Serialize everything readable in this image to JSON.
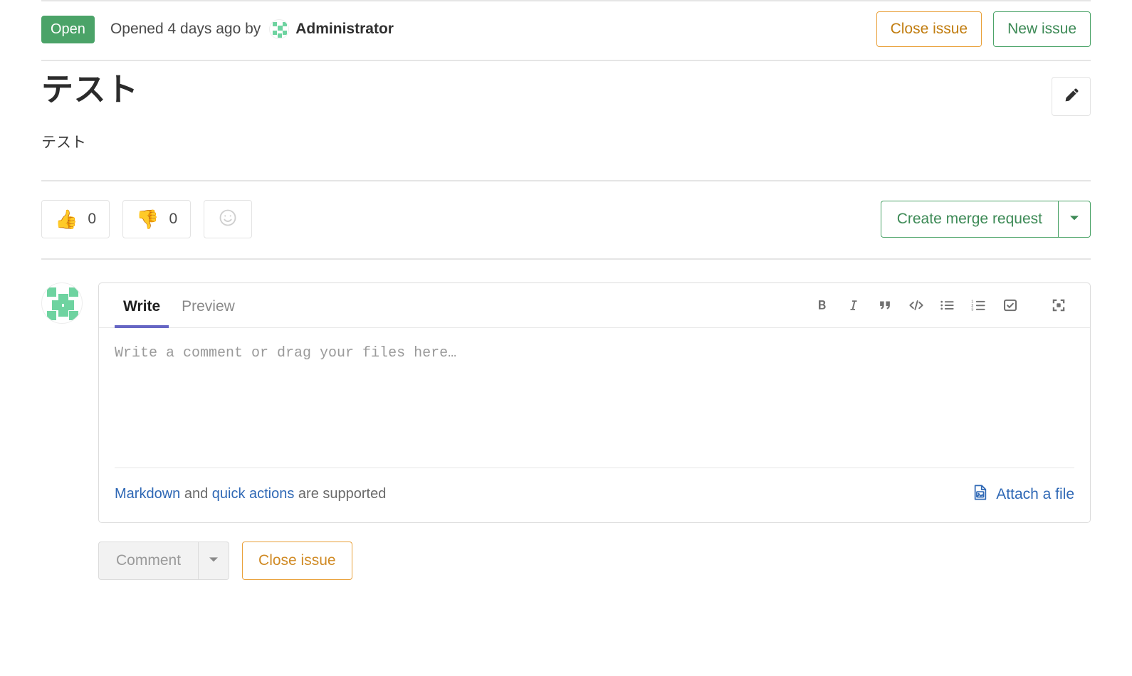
{
  "header": {
    "state_badge": "Open",
    "opened_text": "Opened 4 days ago by",
    "author": "Administrator",
    "close_issue_label": "Close issue",
    "new_issue_label": "New issue"
  },
  "issue": {
    "title": "テスト",
    "description": "テスト",
    "edit_icon": "pencil-icon"
  },
  "awards": {
    "thumbsup_emoji": "👍",
    "thumbsup_count": "0",
    "thumbsdown_emoji": "👎",
    "thumbsdown_count": "0",
    "add_reaction_icon": "smiley-icon",
    "create_merge_request_label": "Create merge request",
    "merge_request_caret_icon": "chevron-down-icon"
  },
  "comment_form": {
    "tabs": [
      {
        "label": "Write",
        "active": true
      },
      {
        "label": "Preview",
        "active": false
      }
    ],
    "toolbar": [
      {
        "name": "bold-icon",
        "glyph": "B"
      },
      {
        "name": "italic-icon",
        "glyph": "I"
      },
      {
        "name": "quote-icon",
        "glyph": "”"
      },
      {
        "name": "code-icon",
        "glyph": "</>"
      },
      {
        "name": "bullet-list-icon",
        "glyph": ""
      },
      {
        "name": "numbered-list-icon",
        "glyph": ""
      },
      {
        "name": "task-list-icon",
        "glyph": ""
      },
      {
        "name": "fullscreen-icon",
        "glyph": ""
      }
    ],
    "placeholder": "Write a comment or drag your files here…",
    "value": "",
    "support_prefix": "",
    "markdown_link": "Markdown",
    "support_middle": " and ",
    "quick_actions_link": "quick actions",
    "support_suffix": " are supported",
    "attach_label": "Attach a file",
    "attach_icon": "image-file-icon"
  },
  "actions": {
    "comment_label": "Comment",
    "comment_caret_icon": "chevron-down-icon",
    "close_issue_label": "Close issue"
  },
  "colors": {
    "open_green": "#4ba368",
    "warning_orange": "#e9a13b",
    "link_blue": "#2f68b5",
    "tab_accent": "#6666c4",
    "identicon_green": "#6ed3a0"
  }
}
